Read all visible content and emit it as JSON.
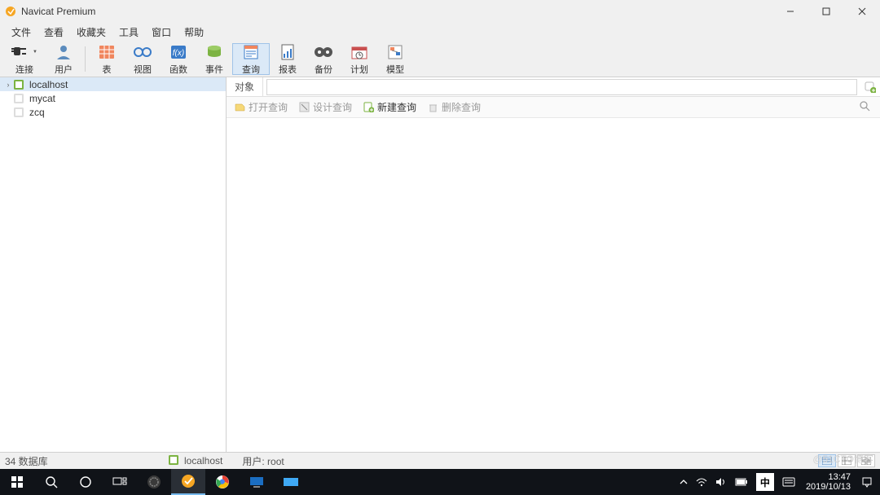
{
  "window": {
    "title": "Navicat Premium"
  },
  "menu": [
    "文件",
    "查看",
    "收藏夹",
    "工具",
    "窗口",
    "帮助"
  ],
  "toolbar": [
    {
      "id": "connect",
      "label": "连接",
      "icon": "plug",
      "dropdown": true
    },
    {
      "id": "user",
      "label": "用户",
      "icon": "user"
    },
    {
      "sep": true
    },
    {
      "id": "table",
      "label": "表",
      "icon": "table"
    },
    {
      "id": "view",
      "label": "视图",
      "icon": "view"
    },
    {
      "id": "function",
      "label": "函数",
      "icon": "fx"
    },
    {
      "id": "event",
      "label": "事件",
      "icon": "event"
    },
    {
      "id": "query",
      "label": "查询",
      "icon": "query",
      "selected": true
    },
    {
      "id": "report",
      "label": "报表",
      "icon": "report"
    },
    {
      "id": "backup",
      "label": "备份",
      "icon": "backup"
    },
    {
      "id": "schedule",
      "label": "计划",
      "icon": "schedule"
    },
    {
      "id": "model",
      "label": "模型",
      "icon": "model"
    }
  ],
  "connections": [
    {
      "name": "localhost",
      "open": true
    },
    {
      "name": "mycat",
      "open": false
    },
    {
      "name": "zcq",
      "open": false
    }
  ],
  "object_tab": "对象",
  "sub_toolbar": {
    "open_query": "打开查询",
    "design_query": "设计查询",
    "new_query": "新建查询",
    "delete_query": "删除查询"
  },
  "status": {
    "db_count": "34 数据库",
    "connection": "localhost",
    "user_label": "用户: root"
  },
  "taskbar": {
    "time": "13:47",
    "date": "2019/10/13",
    "ime": "中"
  },
  "watermark": "@51CTO博客"
}
